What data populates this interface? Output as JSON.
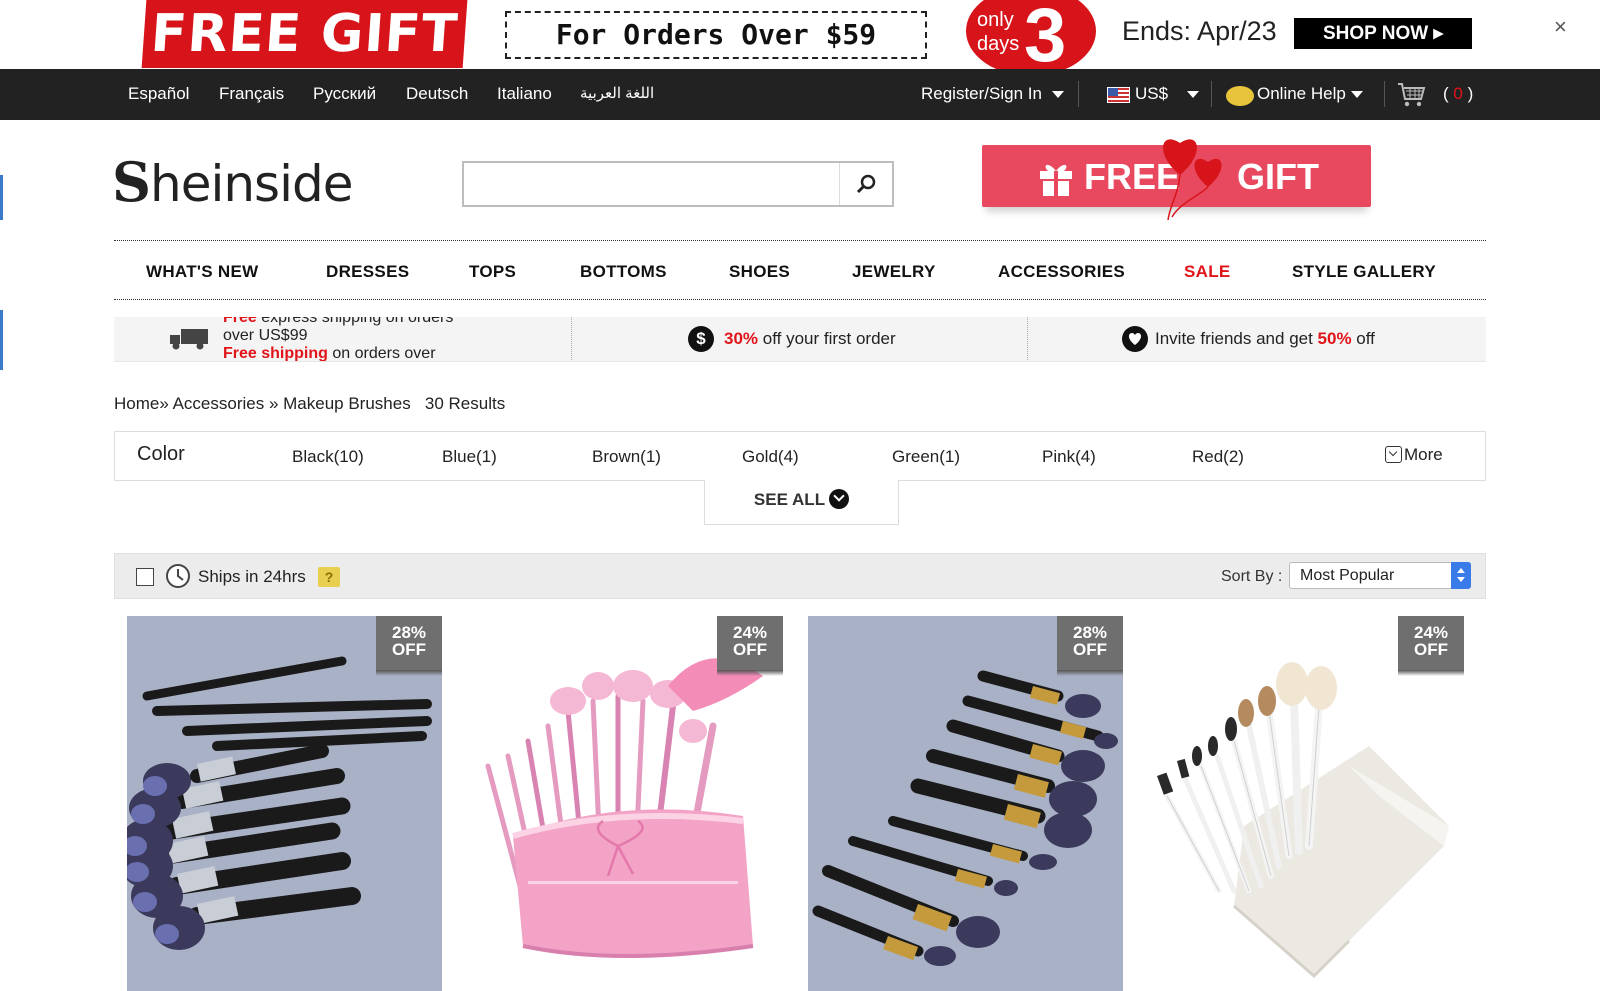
{
  "promo": {
    "gift_text": "FREE GIFT",
    "orders_text": "For Orders Over $59",
    "days_label": "only days",
    "days_number": "3",
    "ends_text": "Ends: Apr/23",
    "shop_button": "SHOP NOW ▸",
    "close_glyph": "×"
  },
  "topbar": {
    "languages": [
      "Español",
      "Français",
      "Русский",
      "Deutsch",
      "Italiano",
      "اللغة العربية"
    ],
    "register": "Register/Sign In",
    "currency": "US$",
    "help": "Online Help",
    "cart_open": "(",
    "cart_count": "0",
    "cart_close": ")"
  },
  "header": {
    "logo_first": "S",
    "logo_rest": "heinside",
    "search_placeholder": "",
    "gift_word1": "FREE",
    "gift_word2": "GIFT"
  },
  "categories": [
    "WHAT'S NEW",
    "DRESSES",
    "TOPS",
    "BOTTOMS",
    "SHOES",
    "JEWELRY",
    "ACCESSORIES",
    "SALE",
    "STYLE GALLERY"
  ],
  "info": {
    "ship_red_top": "Free",
    "ship_line1": " express shipping on orders",
    "ship_line2": "over US$99",
    "ship_red_bottom": "Free shipping",
    "ship_line3": " on orders over",
    "first_order_pct": "30%",
    "first_order_text": " off your first order",
    "invite_text": "Invite friends and get ",
    "invite_pct": "50%",
    "invite_suffix": " off",
    "coin_glyph": "$"
  },
  "breadcrumb": {
    "home": "Home»",
    "accessories": " Accessories »",
    "current": " Makeup Brushes",
    "results": "30 Results"
  },
  "filter": {
    "title": "Color",
    "options": [
      "Black(10)",
      "Blue(1)",
      "Brown(1)",
      "Gold(4)",
      "Green(1)",
      "Pink(4)",
      "Red(2)"
    ],
    "more": "More",
    "see_all": "SEE ALL"
  },
  "toolbar": {
    "ships_label": "Ships in 24hrs",
    "help_glyph": "?",
    "sort_label": "Sort By :",
    "sort_value": "Most Popular"
  },
  "products": [
    {
      "discount_pct": "28%",
      "discount_off": "OFF"
    },
    {
      "discount_pct": "24%",
      "discount_off": "OFF"
    },
    {
      "discount_pct": "28%",
      "discount_off": "OFF"
    },
    {
      "discount_pct": "24%",
      "discount_off": "OFF"
    }
  ],
  "colors": {
    "accent_red": "#e1141a",
    "topbar_bg": "#222222",
    "gift_pink": "#e8495e",
    "sort_blue": "#3a7bea"
  }
}
